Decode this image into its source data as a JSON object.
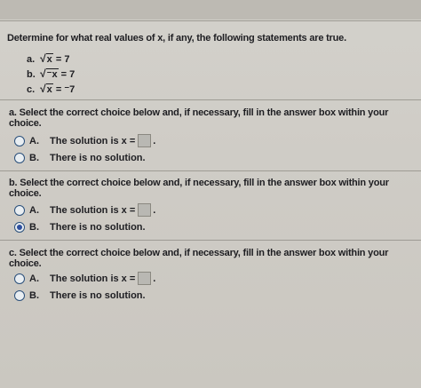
{
  "question": "Determine for what real values of x, if any, the following statements are true.",
  "statements": [
    {
      "label": "a.",
      "text_pre": "√",
      "radicand": "x",
      "text_post": " = 7"
    },
    {
      "label": "b.",
      "text_pre": "√",
      "radicand": "⁻x",
      "text_post": " = 7"
    },
    {
      "label": "c.",
      "text_pre": "√",
      "radicand": "x",
      "text_post": " = ⁻7"
    }
  ],
  "parts": [
    {
      "heading": "a. Select the correct choice below and, if necessary, fill in the answer box within your choice.",
      "choice_a_letter": "A.",
      "choice_a_text": "The solution is x =",
      "choice_a_selected": false,
      "choice_b_letter": "B.",
      "choice_b_text": "There is no solution.",
      "choice_b_selected": false
    },
    {
      "heading": "b. Select the correct choice below and, if necessary, fill in the answer box within your choice.",
      "choice_a_letter": "A.",
      "choice_a_text": "The solution is x =",
      "choice_a_selected": false,
      "choice_b_letter": "B.",
      "choice_b_text": "There is no solution.",
      "choice_b_selected": true
    },
    {
      "heading": "c. Select the correct choice below and, if necessary, fill in the answer box within your choice.",
      "choice_a_letter": "A.",
      "choice_a_text": "The solution is x =",
      "choice_a_selected": false,
      "choice_b_letter": "B.",
      "choice_b_text": "There is no solution.",
      "choice_b_selected": false
    }
  ],
  "answer_suffix": ".",
  "colors": {
    "radio_border": "#2a4f7a",
    "radio_fill": "#2e4f9e"
  }
}
